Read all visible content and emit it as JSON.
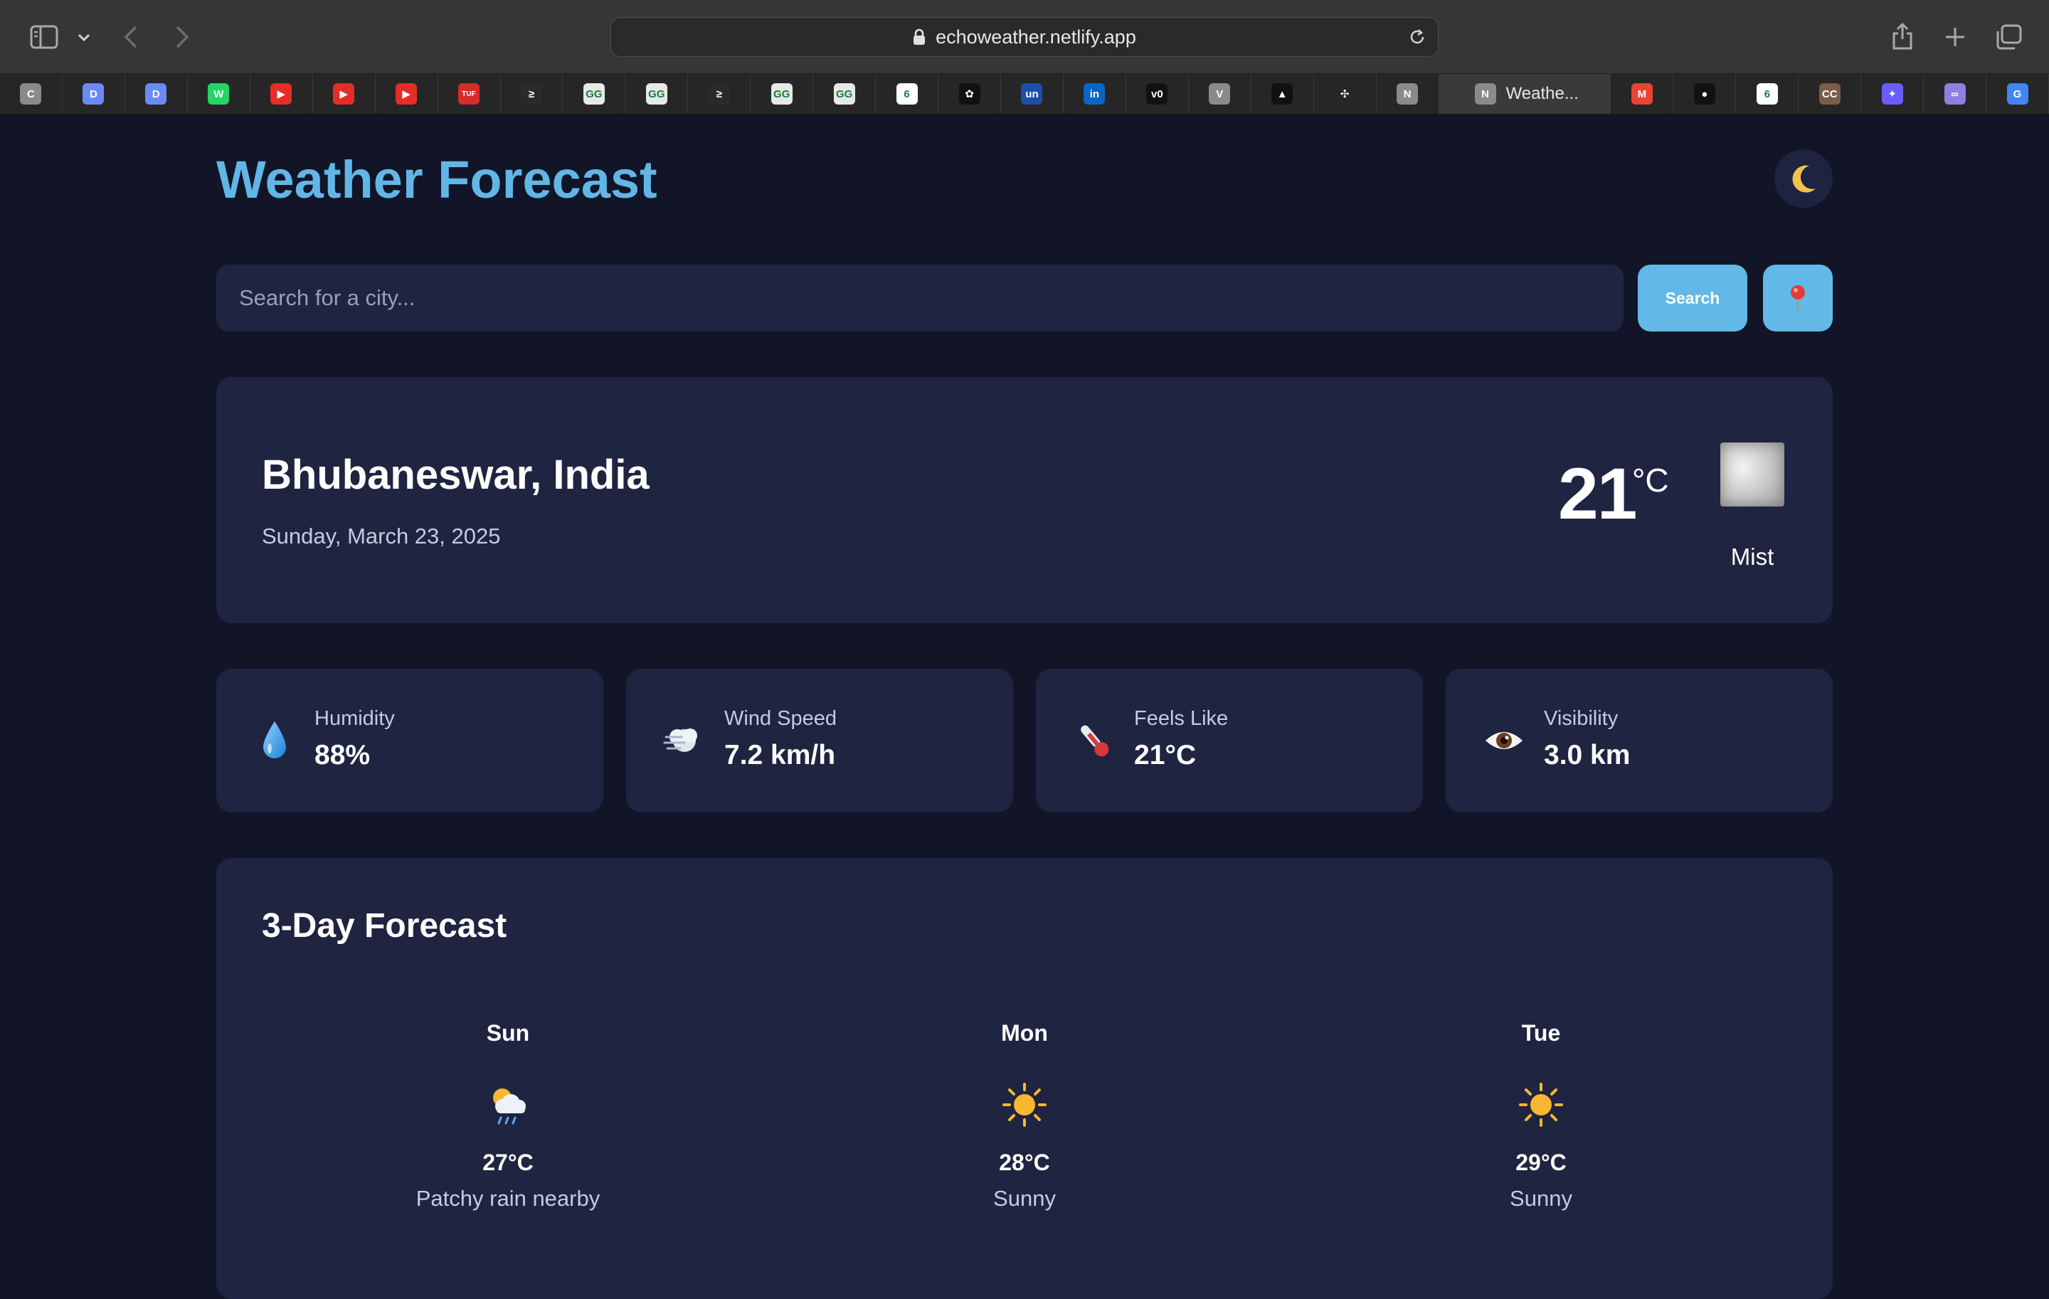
{
  "browser": {
    "url": "echoweather.netlify.app",
    "active_tab_title": "Weathe...",
    "tabs": [
      {
        "icon": "c-favicon",
        "letter": "C",
        "color": "#8a8a8a"
      },
      {
        "icon": "deepseek-favicon",
        "letter": "D",
        "color": "#6b8af5"
      },
      {
        "icon": "deepseek-favicon",
        "letter": "D",
        "color": "#6b8af5"
      },
      {
        "icon": "whatsapp-favicon",
        "letter": "W",
        "color": "#25d366"
      },
      {
        "icon": "youtube-favicon",
        "letter": "▶",
        "color": "#e52d27"
      },
      {
        "icon": "youtube-favicon",
        "letter": "▶",
        "color": "#e52d27"
      },
      {
        "icon": "youtube-favicon",
        "letter": "▶",
        "color": "#e52d27"
      },
      {
        "icon": "tuf-favicon",
        "letter": "TUF",
        "color": "#d62b2b"
      },
      {
        "icon": "codolio-favicon",
        "letter": "≥",
        "color": "#2a2a2a"
      },
      {
        "icon": "geeksforgeeks-favicon",
        "letter": "GG",
        "color": "#e8e8e8"
      },
      {
        "icon": "geeksforgeeks-favicon",
        "letter": "GG",
        "color": "#e8e8e8"
      },
      {
        "icon": "codolio-favicon",
        "letter": "≥",
        "color": "#2a2a2a"
      },
      {
        "icon": "geeksforgeeks-favicon",
        "letter": "GG",
        "color": "#e8e8e8"
      },
      {
        "icon": "geeksforgeeks-favicon",
        "letter": "GG",
        "color": "#e8e8e8"
      },
      {
        "icon": "spiral-favicon",
        "letter": "6",
        "color": "#ffffff"
      },
      {
        "icon": "openai-favicon",
        "letter": "✿",
        "color": "#111111"
      },
      {
        "icon": "unstop-favicon",
        "letter": "un",
        "color": "#1c4fa8"
      },
      {
        "icon": "linkedin-favicon",
        "letter": "in",
        "color": "#0a66c2"
      },
      {
        "icon": "v0-favicon",
        "letter": "v0",
        "color": "#111111"
      },
      {
        "icon": "v-favicon",
        "letter": "V",
        "color": "#8a8a8a"
      },
      {
        "icon": "vercel-favicon",
        "letter": "▲",
        "color": "#111111"
      },
      {
        "icon": "perplexity-favicon",
        "letter": "✣",
        "color": "#262626"
      },
      {
        "icon": "notion-favicon",
        "letter": "N",
        "color": "#8a8a8a"
      }
    ],
    "tabs_after": [
      {
        "icon": "gmail-favicon",
        "letter": "M",
        "color": "#ea4335"
      },
      {
        "icon": "github-favicon",
        "letter": "●",
        "color": "#111111"
      },
      {
        "icon": "spiral-favicon",
        "letter": "6",
        "color": "#ffffff"
      },
      {
        "icon": "cc-favicon",
        "letter": "CC",
        "color": "#7a5c4a"
      },
      {
        "icon": "gemini-favicon",
        "letter": "✦",
        "color": "#6a5cff"
      },
      {
        "icon": "knot-favicon",
        "letter": "∞",
        "color": "#8f7fe0"
      },
      {
        "icon": "google-favicon",
        "letter": "G",
        "color": "#4285f4"
      }
    ],
    "active_tab_icon": {
      "letter": "N",
      "color": "#8a8a8a"
    }
  },
  "app": {
    "title": "Weather Forecast",
    "search_placeholder": "Search for a city...",
    "search_button": "Search",
    "accent_color": "#62b6e6"
  },
  "current": {
    "location": "Bhubaneswar, India",
    "date": "Sunday, March 23, 2025",
    "temperature": "21",
    "unit": "°C",
    "condition": "Mist",
    "icon": "mist-icon"
  },
  "stats": [
    {
      "label": "Humidity",
      "value": "88%",
      "icon": "droplet-icon"
    },
    {
      "label": "Wind Speed",
      "value": "7.2 km/h",
      "icon": "wind-icon"
    },
    {
      "label": "Feels Like",
      "value": "21°C",
      "icon": "thermometer-icon"
    },
    {
      "label": "Visibility",
      "value": "3.0 km",
      "icon": "eye-icon"
    }
  ],
  "forecast": {
    "title": "3-Day Forecast",
    "days": [
      {
        "day": "Sun",
        "temp": "27°C",
        "condition": "Patchy rain nearby",
        "icon": "sun-rain-cloud-icon"
      },
      {
        "day": "Mon",
        "temp": "28°C",
        "condition": "Sunny",
        "icon": "sun-icon"
      },
      {
        "day": "Tue",
        "temp": "29°C",
        "condition": "Sunny",
        "icon": "sun-icon"
      }
    ]
  }
}
